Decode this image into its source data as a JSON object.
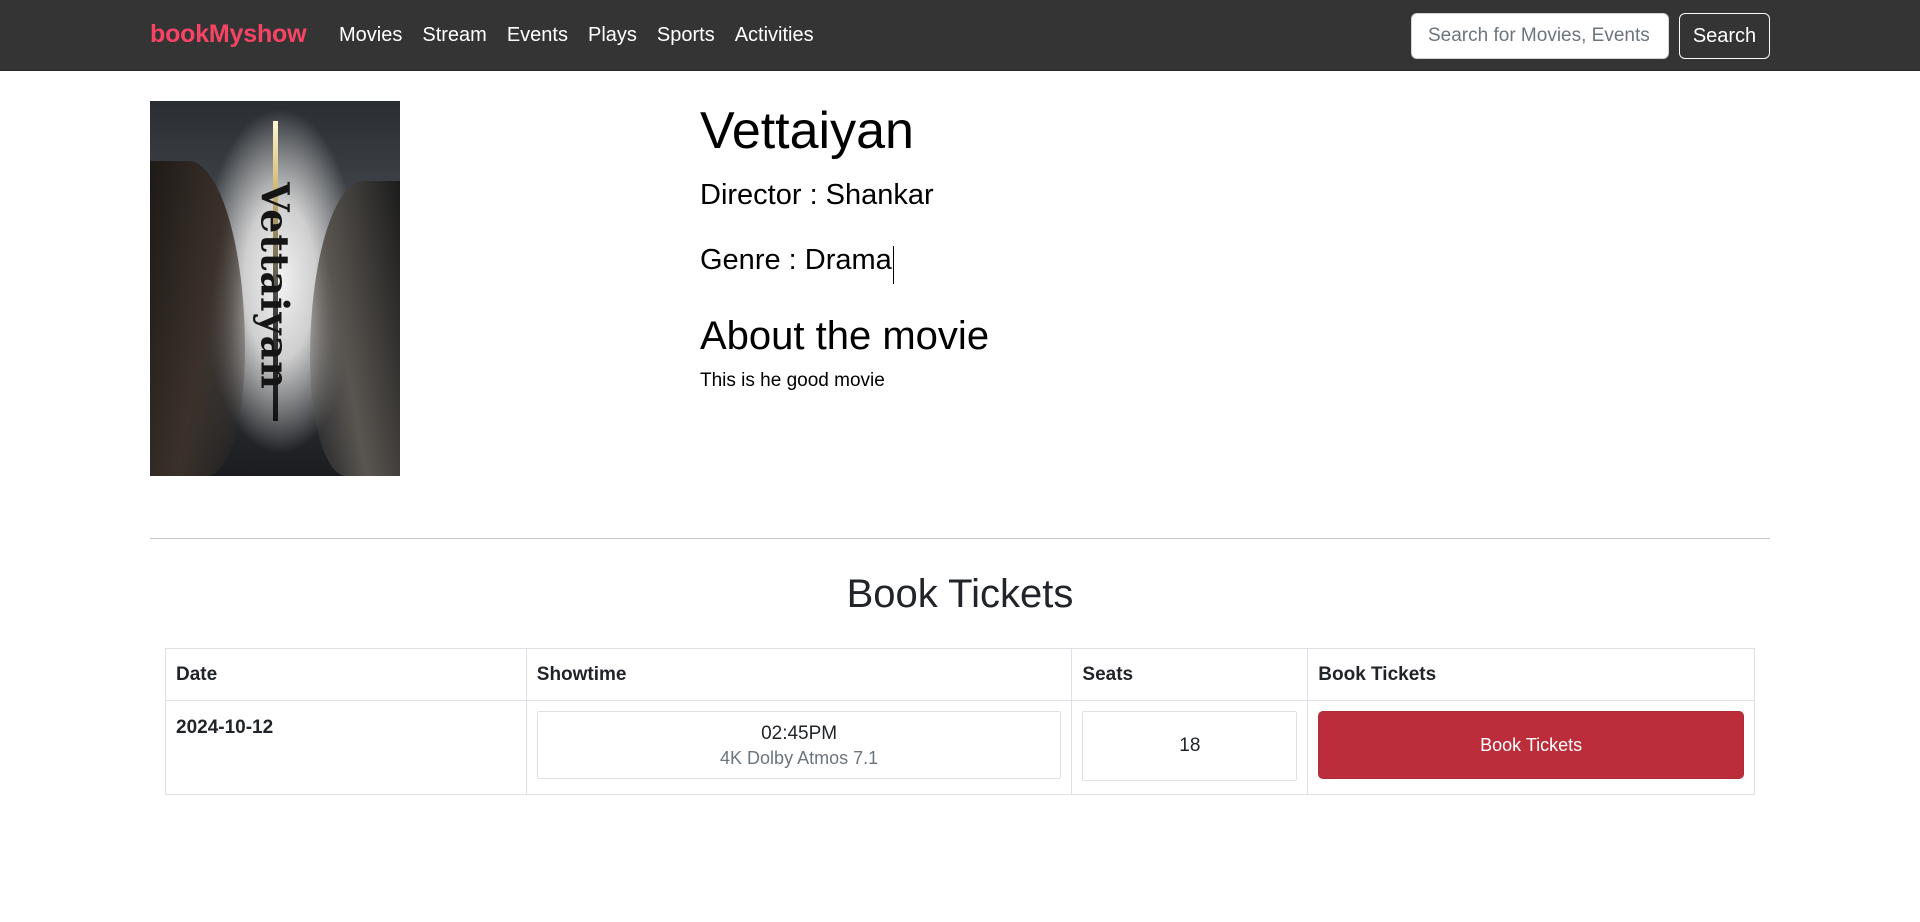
{
  "navbar": {
    "brand": "bookMyshow",
    "links": [
      "Movies",
      "Stream",
      "Events",
      "Plays",
      "Sports",
      "Activities"
    ],
    "search_placeholder": "Search for Movies, Events",
    "search_button": "Search"
  },
  "movie": {
    "poster_text": "Vettaiyan",
    "title": "Vettaiyan",
    "director": "Director : Shankar",
    "genre": "Genre : Drama",
    "about_heading": "About the movie",
    "about_text": "This is he good movie"
  },
  "booking": {
    "heading": "Book Tickets",
    "columns": [
      "Date",
      "Showtime",
      "Seats",
      "Book Tickets"
    ],
    "rows": [
      {
        "date": "2024-10-12",
        "time": "02:45PM",
        "format": "4K Dolby Atmos 7.1",
        "seats": "18",
        "button": "Book Tickets"
      }
    ]
  },
  "colors": {
    "navbar_bg": "#343434",
    "brand": "#f84464",
    "book_button": "#bb2d3b"
  }
}
